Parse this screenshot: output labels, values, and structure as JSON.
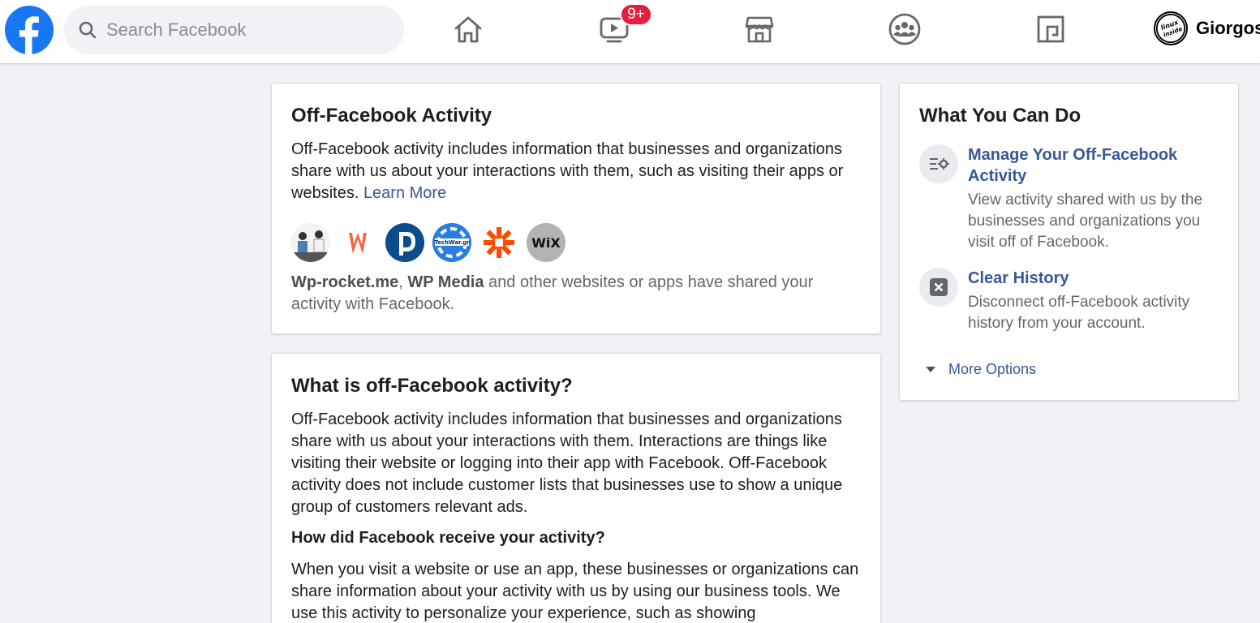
{
  "header": {
    "search_placeholder": "Search Facebook",
    "watch_badge": "9+",
    "profile_name": "Giorgos"
  },
  "off_facebook": {
    "title": "Off-Facebook Activity",
    "description": "Off-Facebook activity includes information that businesses and organizations share with us about your interactions with them, such as visiting their apps or websites.",
    "learn_more": "Learn More",
    "app_icons": [
      "linux-inside-photo-icon",
      "wp-rocket-icon",
      "wp-media-icon",
      "techwar-icon",
      "zapier-icon",
      "wix-icon"
    ],
    "shared_app_1": "Wp-rocket.me",
    "shared_sep": ",",
    "shared_app_2": "WP Media",
    "shared_rest": "and other websites or apps have shared your activity with Facebook."
  },
  "what_is": {
    "title": "What is off-Facebook activity?",
    "paragraph": "Off-Facebook activity includes information that businesses and organizations share with us about your interactions with them. Interactions are things like visiting their website or logging into their app with Facebook. Off-Facebook activity does not include customer lists that businesses use to show a unique group of customers relevant ads.",
    "subheading": "How did Facebook receive your activity?",
    "paragraph2": "When you visit a website or use an app, these businesses or organizations can share information about your activity with us by using our business tools. We use this activity to personalize your experience, such as showing"
  },
  "sidebar": {
    "title": "What You Can Do",
    "items": [
      {
        "title": "Manage Your Off-Facebook Activity",
        "description": "View activity shared with us by the businesses and organizations you visit off of Facebook."
      },
      {
        "title": "Clear History",
        "description": "Disconnect off-Facebook activity history from your account."
      }
    ],
    "more_options": "More Options"
  },
  "colors": {
    "facebook_blue": "#1877f2",
    "link_blue": "#385898",
    "badge_red": "#e41e3f",
    "background": "#f0f2f5"
  }
}
